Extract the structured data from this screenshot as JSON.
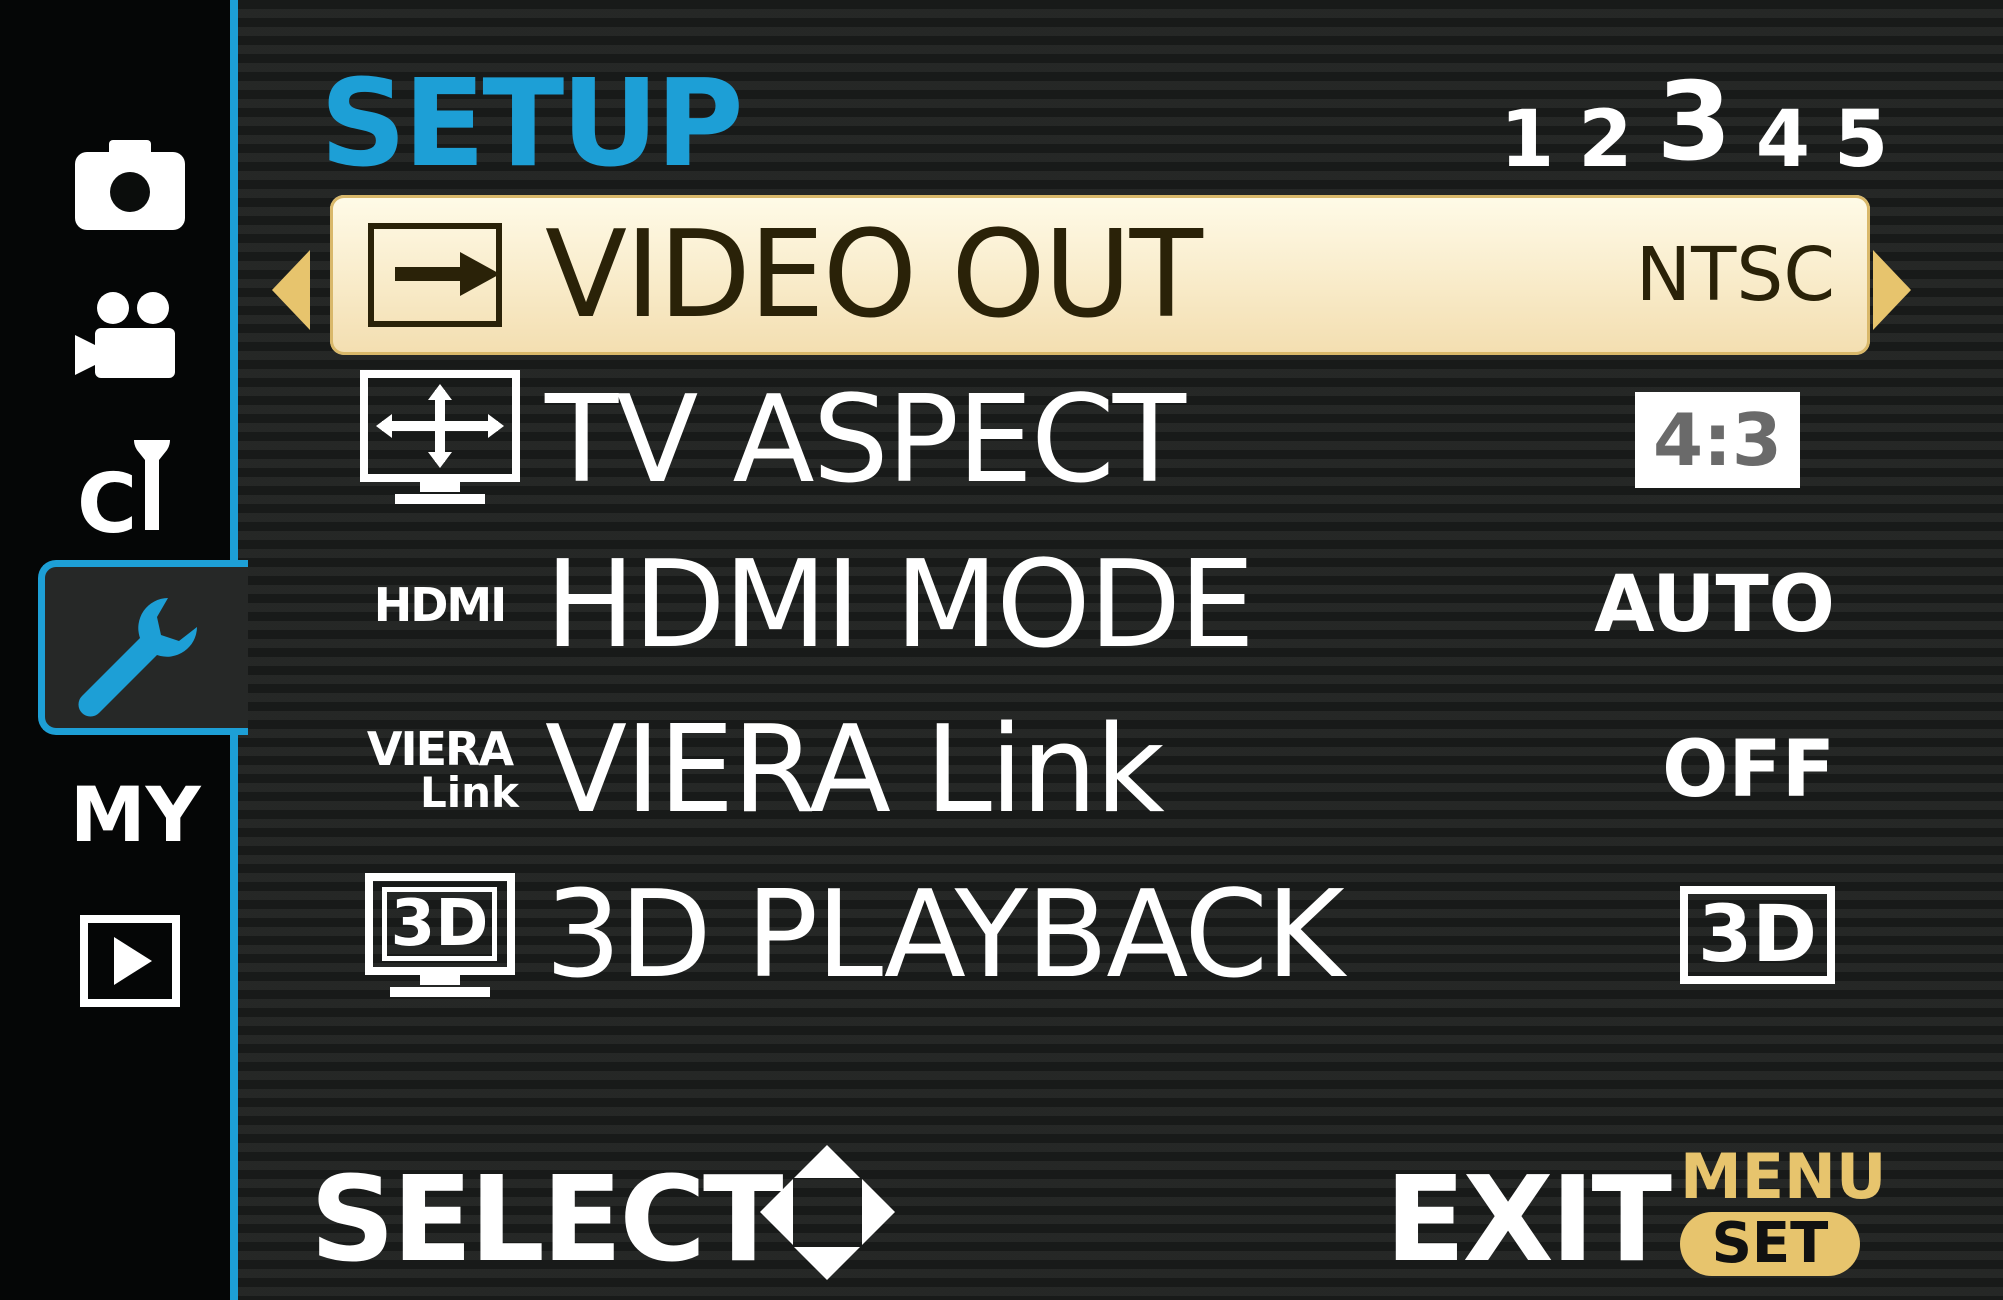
{
  "header": {
    "title": "SETUP",
    "pages": [
      "1",
      "2",
      "3",
      "4",
      "5"
    ],
    "active_page": "3"
  },
  "sidebar": {
    "tabs": [
      {
        "name": "camera-icon"
      },
      {
        "name": "movie-camera-icon"
      },
      {
        "name": "custom-icon",
        "label": "C"
      },
      {
        "name": "wrench-icon"
      },
      {
        "name": "my-menu-icon",
        "label": "MY"
      },
      {
        "name": "playback-icon"
      }
    ],
    "active_tab": "wrench-icon"
  },
  "menu": {
    "items": [
      {
        "label": "VIDEO OUT",
        "value": "NTSC",
        "icon": "video-out-icon",
        "selected": true
      },
      {
        "label": "TV ASPECT",
        "value": "4:3",
        "icon": "tv-aspect-icon",
        "selected": false
      },
      {
        "label": "HDMI MODE",
        "value": "AUTO",
        "icon": "hdmi-icon",
        "icon_text": "HDMI",
        "selected": false
      },
      {
        "label": "VIERA Link",
        "value": "OFF",
        "icon": "viera-link-icon",
        "icon_text_top": "VIERA",
        "icon_text_bottom": "Link",
        "selected": false
      },
      {
        "label": "3D PLAYBACK",
        "value": "3D",
        "icon": "3d-playback-icon",
        "icon_text": "3D",
        "selected": false
      }
    ]
  },
  "footer": {
    "select_label": "SELECT",
    "exit_label": "EXIT",
    "menu_label": "MENU",
    "set_label": "SET"
  },
  "colors": {
    "accent": "#1d9fd6",
    "highlight": "#f3deb0",
    "button_gold": "#e7c46d"
  }
}
